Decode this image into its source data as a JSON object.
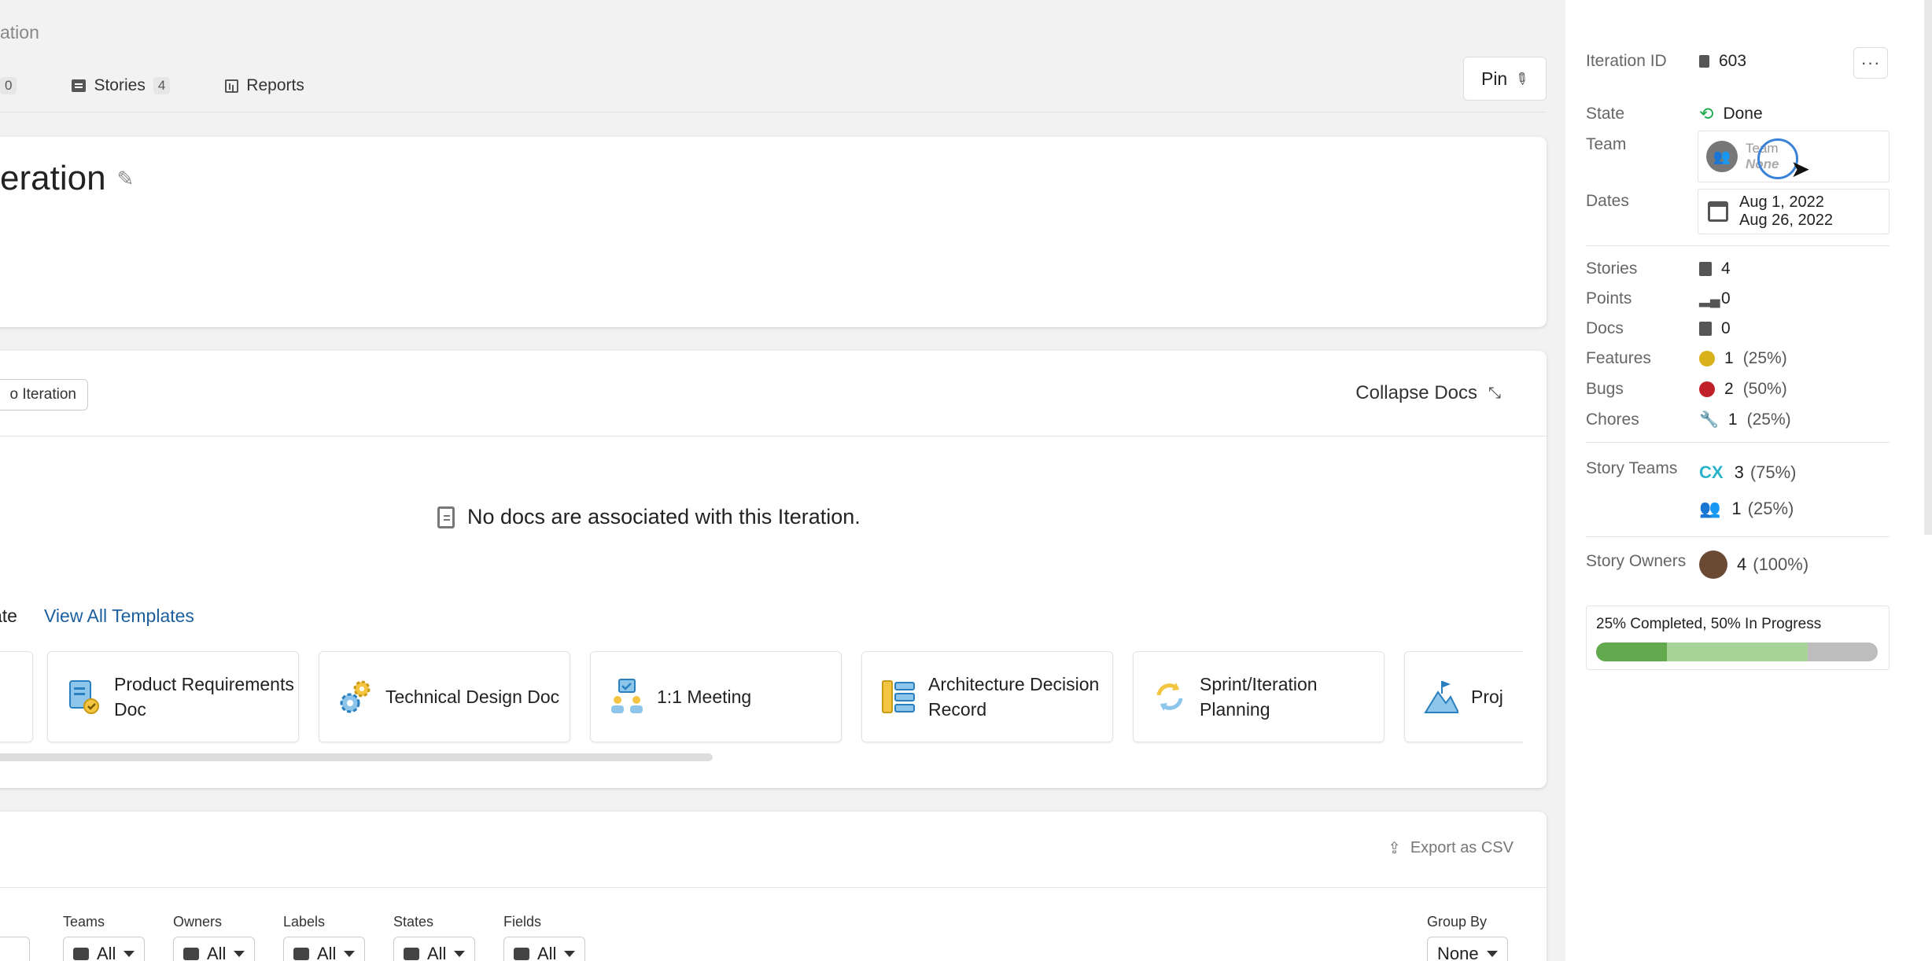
{
  "breadcrumb": "ation",
  "tabs": [
    {
      "label": "",
      "count": "0"
    },
    {
      "label": "Stories",
      "count": "4"
    },
    {
      "label": "Reports"
    }
  ],
  "pin_label": "Pin",
  "iteration_title": "eration",
  "docs": {
    "add_to_iteration_label": "o Iteration",
    "collapse_label": "Collapse Docs",
    "empty_message": "No docs are associated with this Iteration.",
    "templates_heading": "ate",
    "view_all_label": "View All Templates",
    "templates": [
      {
        "label": "Product Requirements Doc"
      },
      {
        "label": "Technical Design Doc"
      },
      {
        "label": "1:1 Meeting"
      },
      {
        "label": "Architecture Decision Record"
      },
      {
        "label": "Sprint/Iteration Planning"
      },
      {
        "label": "Proj"
      }
    ]
  },
  "stories": {
    "export_label": "Export as CSV",
    "filters": [
      {
        "label": "Teams",
        "value": "All"
      },
      {
        "label": "Owners",
        "value": "All"
      },
      {
        "label": "Labels",
        "value": "All"
      },
      {
        "label": "States",
        "value": "All"
      },
      {
        "label": "Fields",
        "value": "All"
      }
    ],
    "group_by": {
      "label": "Group By",
      "value": "None"
    }
  },
  "sidebar": {
    "iteration_id": {
      "label": "Iteration ID",
      "value": "603"
    },
    "more_label": "···",
    "state": {
      "label": "State",
      "value": "Done"
    },
    "team": {
      "label": "Team",
      "caption": "Team",
      "value": "None"
    },
    "dates": {
      "label": "Dates",
      "start": "Aug 1, 2022",
      "end": "Aug 26, 2022"
    },
    "stories": {
      "label": "Stories",
      "value": "4"
    },
    "points": {
      "label": "Points",
      "value": "0"
    },
    "docs": {
      "label": "Docs",
      "value": "0"
    },
    "features": {
      "label": "Features",
      "value": "1",
      "pct": "(25%)"
    },
    "bugs": {
      "label": "Bugs",
      "value": "2",
      "pct": "(50%)"
    },
    "chores": {
      "label": "Chores",
      "value": "1",
      "pct": "(25%)"
    },
    "story_teams": {
      "label": "Story Teams",
      "teams": [
        {
          "icon": "cx-team-logo",
          "value": "3",
          "pct": "(75%)"
        },
        {
          "icon": "people-icon",
          "value": "1",
          "pct": "(25%)"
        }
      ]
    },
    "story_owners": {
      "label": "Story Owners",
      "value": "4",
      "pct": "(100%)"
    },
    "progress": {
      "text": "25% Completed, 50% In Progress",
      "completed": 0.25,
      "in_progress": 0.5
    }
  },
  "colors": {
    "done_green": "#1aa84b",
    "link_blue": "#1b5f9e",
    "progress_completed": "#62a84d",
    "progress_in_progress": "#a8d49a",
    "progress_remaining": "#bdbdbd",
    "feature_yellow": "#d9b11b",
    "bug_red": "#c0202a",
    "team_blue": "#2a8fd0"
  }
}
